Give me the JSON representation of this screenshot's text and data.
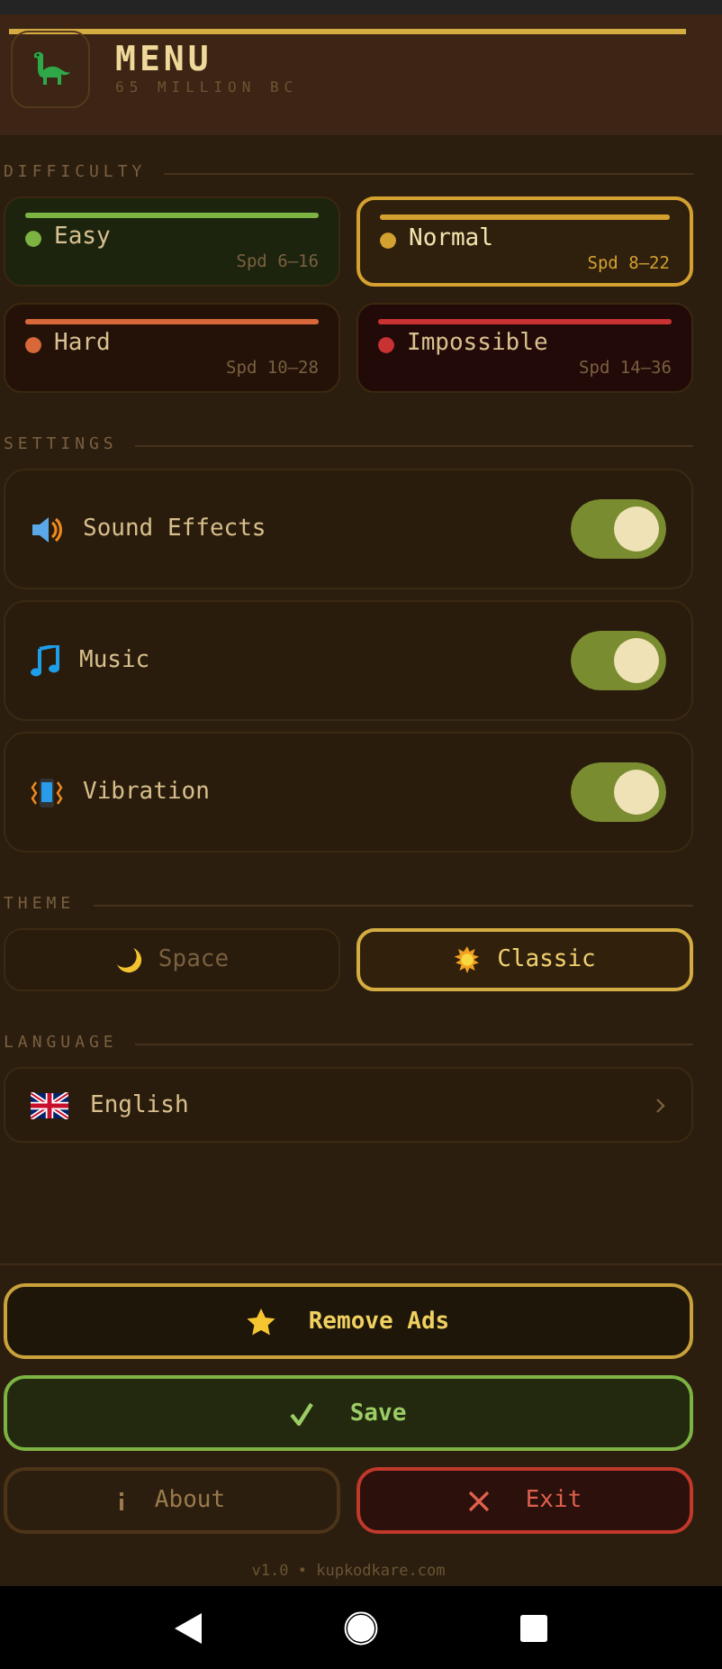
{
  "header": {
    "title": "MENU",
    "subtitle": "65 MILLION BC"
  },
  "difficulty": {
    "label": "DIFFICULTY",
    "levels": [
      {
        "name": "Easy",
        "speed": "Spd 6–16",
        "color": "#7cb342",
        "selected": false
      },
      {
        "name": "Normal",
        "speed": "Spd 8–22",
        "color": "#d4a030",
        "selected": true
      },
      {
        "name": "Hard",
        "speed": "Spd 10–28",
        "color": "#d8683a",
        "selected": false
      },
      {
        "name": "Impossible",
        "speed": "Spd 14–36",
        "color": "#c83232",
        "selected": false
      }
    ]
  },
  "settings": {
    "label": "SETTINGS",
    "items": [
      {
        "label": "Sound Effects",
        "on": true
      },
      {
        "label": "Music",
        "on": true
      },
      {
        "label": "Vibration",
        "on": true
      }
    ]
  },
  "theme": {
    "label": "THEME",
    "options": [
      {
        "label": "Space",
        "selected": false
      },
      {
        "label": "Classic",
        "selected": true
      }
    ]
  },
  "language": {
    "label": "LANGUAGE",
    "value": "English"
  },
  "actions": [
    {
      "kind": "premium",
      "label": "Remove Ads"
    },
    {
      "kind": "confirm",
      "label": "Save"
    }
  ],
  "secondary_actions": [
    {
      "kind": "info",
      "label": "About"
    },
    {
      "kind": "danger",
      "label": "Exit"
    }
  ],
  "footer": "v1.0 • kupkodkare.com"
}
